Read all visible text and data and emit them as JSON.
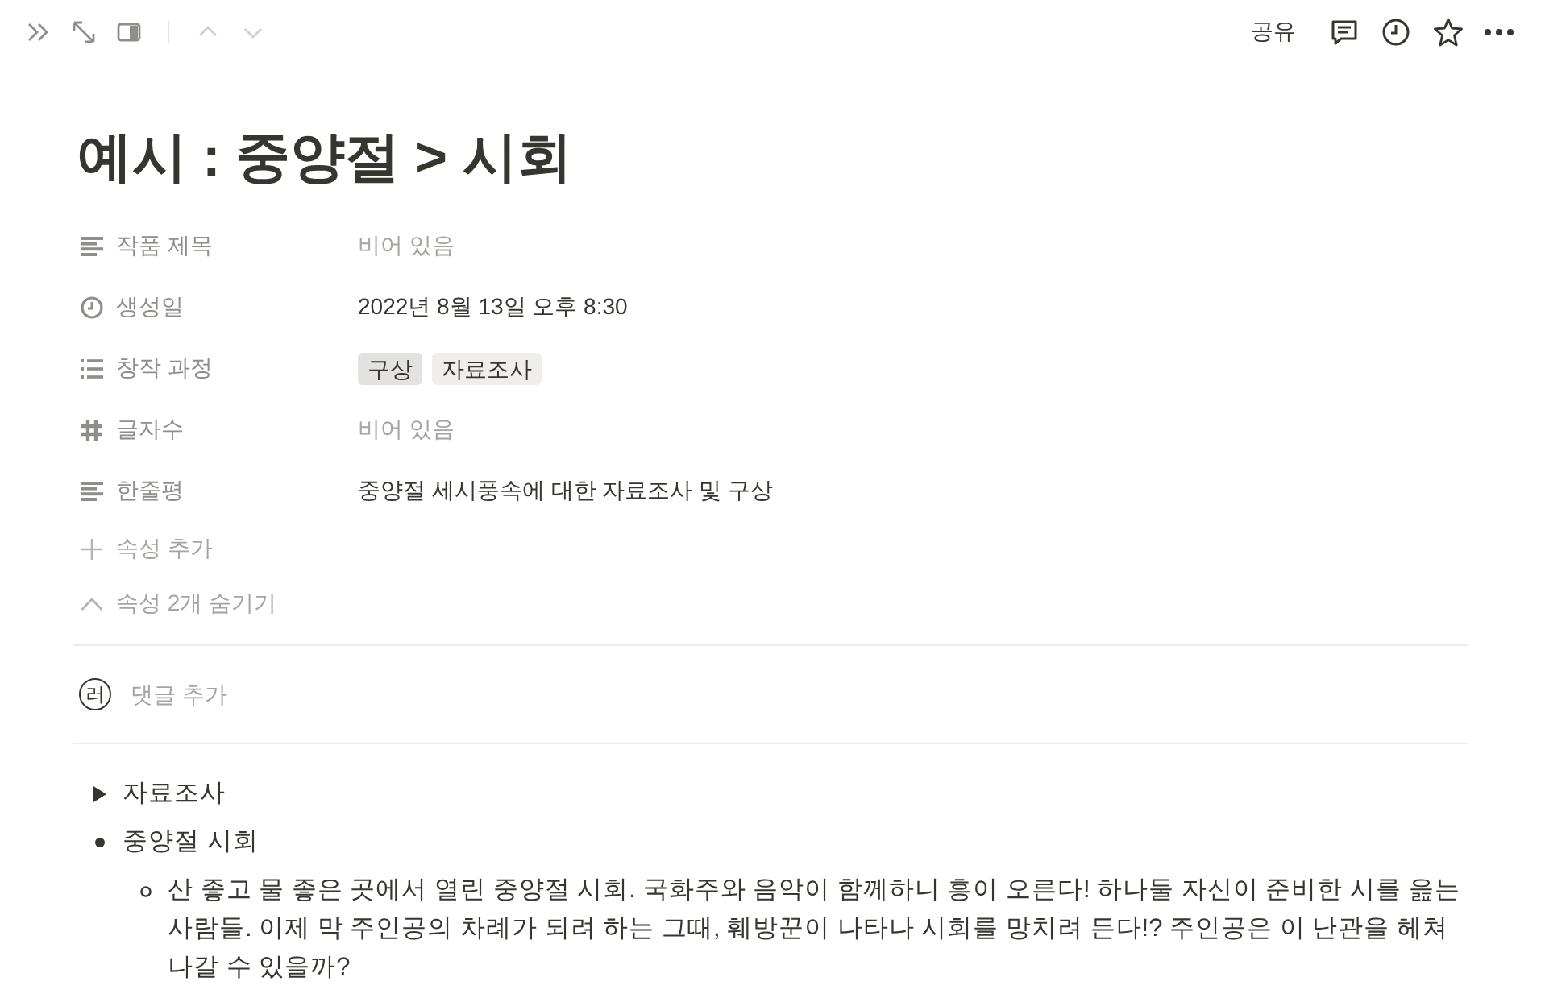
{
  "topbar": {
    "navigation": [
      {
        "kind": "up",
        "disabled": true
      },
      {
        "kind": "down",
        "disabled": true
      }
    ],
    "share_label": "공유"
  },
  "title": "예시 : 중양절 > 시회",
  "properties": [
    {
      "kind": "text",
      "name": "작품 제목",
      "value": "비어 있음",
      "empty": true
    },
    {
      "kind": "created_time",
      "name": "생성일",
      "value": "2022년 8월 13일 오후 8:30",
      "empty": false
    },
    {
      "kind": "multi_select",
      "name": "창작 과정",
      "tags": [
        {
          "label": "구상",
          "color": "#e3e2e0"
        },
        {
          "label": "자료조사",
          "color": "#efeeec"
        }
      ]
    },
    {
      "kind": "number",
      "name": "글자수",
      "value": "비어 있음",
      "empty": true
    },
    {
      "kind": "text",
      "name": "한줄평",
      "value": "중양절 세시풍속에 대한 자료조사 및 구상",
      "empty": false
    }
  ],
  "add_property": "속성 추가",
  "hide_properties": "속성 2개 숨기기",
  "comment": {
    "avatar": "러",
    "placeholder": "댓글 추가"
  },
  "blocks": [
    {
      "kind": "toggle",
      "text": "자료조사",
      "expanded": false
    },
    {
      "kind": "bullet",
      "text": "중양절 시회",
      "children": [
        {
          "kind": "bullet",
          "text": "산 좋고 물 좋은 곳에서 열린 중양절 시회. 국화주와 음악이 함께하니 흥이 오른다! 하나둘 자신이 준비한 시를 읊는 사람들. 이제 막 주인공의 차례가 되려 하는 그때, 훼방꾼이 나타나 시회를 망치려 든다!? 주인공은 이 난관을 헤쳐 나갈 수 있을까?"
        }
      ]
    }
  ]
}
